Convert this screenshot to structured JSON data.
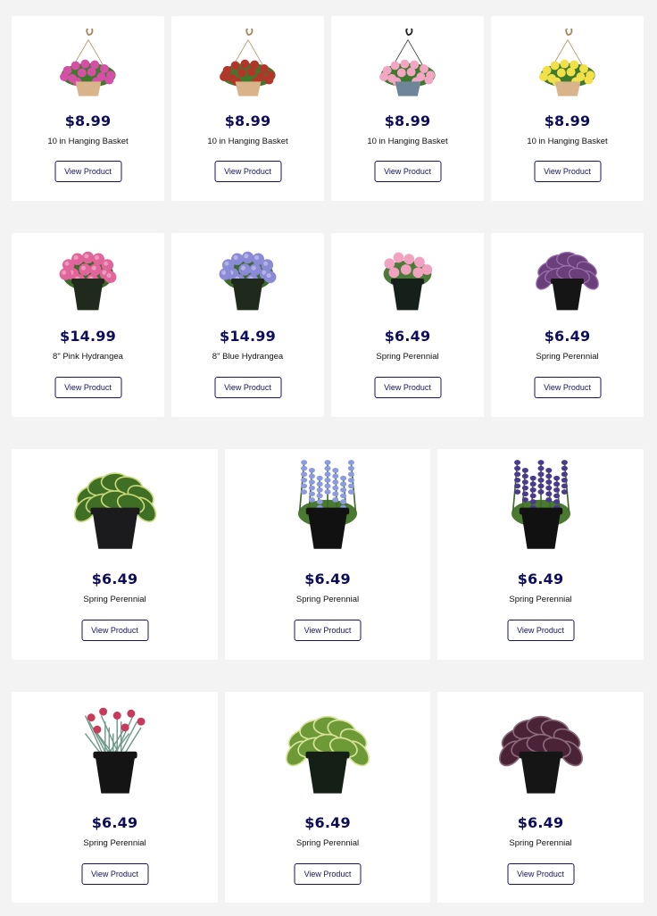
{
  "rows": [
    {
      "products": [
        {
          "price": "$8.99",
          "name": "10 in Hanging Basket",
          "button": "View Product",
          "image": "pink-flower-hanging-basket-icon",
          "color": "#d64fa6"
        },
        {
          "price": "$8.99",
          "name": "10 in Hanging Basket",
          "button": "View Product",
          "image": "coleus-hanging-basket-icon",
          "color": "#b2372b"
        },
        {
          "price": "$8.99",
          "name": "10 in Hanging Basket",
          "button": "View Product",
          "image": "pink-impatiens-hanging-basket-icon",
          "color": "#f2a6c4"
        },
        {
          "price": "$8.99",
          "name": "10 in Hanging Basket",
          "button": "View Product",
          "image": "yellow-flower-hanging-basket-icon",
          "color": "#f2e04a"
        }
      ]
    },
    {
      "products": [
        {
          "price": "$14.99",
          "name": "8\" Pink Hydrangea",
          "button": "View Product",
          "image": "pink-hydrangea-pot-icon",
          "color": "#e1659a"
        },
        {
          "price": "$14.99",
          "name": "8\" Blue Hydrangea",
          "button": "View Product",
          "image": "blue-hydrangea-pot-icon",
          "color": "#8a8ad6"
        },
        {
          "price": "$6.49",
          "name": "Spring Perennial",
          "button": "View Product",
          "image": "pink-dianthus-pot-icon",
          "color": "#f0a2c0"
        },
        {
          "price": "$6.49",
          "name": "Spring Perennial",
          "button": "View Product",
          "image": "purple-heuchera-pot-icon",
          "color": "#6b3f7a"
        }
      ]
    },
    {
      "products": [
        {
          "price": "$6.49",
          "name": "Spring Perennial",
          "button": "View Product",
          "image": "hosta-pot-icon",
          "color": "#5e8f2e"
        },
        {
          "price": "$6.49",
          "name": "Spring Perennial",
          "button": "View Product",
          "image": "blue-salvia-pot-icon",
          "color": "#8c9ae0"
        },
        {
          "price": "$6.49",
          "name": "Spring Perennial",
          "button": "View Product",
          "image": "purple-salvia-pot-icon",
          "color": "#4a3a90"
        }
      ]
    },
    {
      "products": [
        {
          "price": "$6.49",
          "name": "Spring Perennial",
          "button": "View Product",
          "image": "red-dianthus-pot-icon",
          "color": "#c83a5a"
        },
        {
          "price": "$6.49",
          "name": "Spring Perennial",
          "button": "View Product",
          "image": "variegated-hosta-pot-icon",
          "color": "#7fa34a"
        },
        {
          "price": "$6.49",
          "name": "Spring Perennial",
          "button": "View Product",
          "image": "dark-heuchera-pot-icon",
          "color": "#4a2436"
        }
      ]
    }
  ]
}
